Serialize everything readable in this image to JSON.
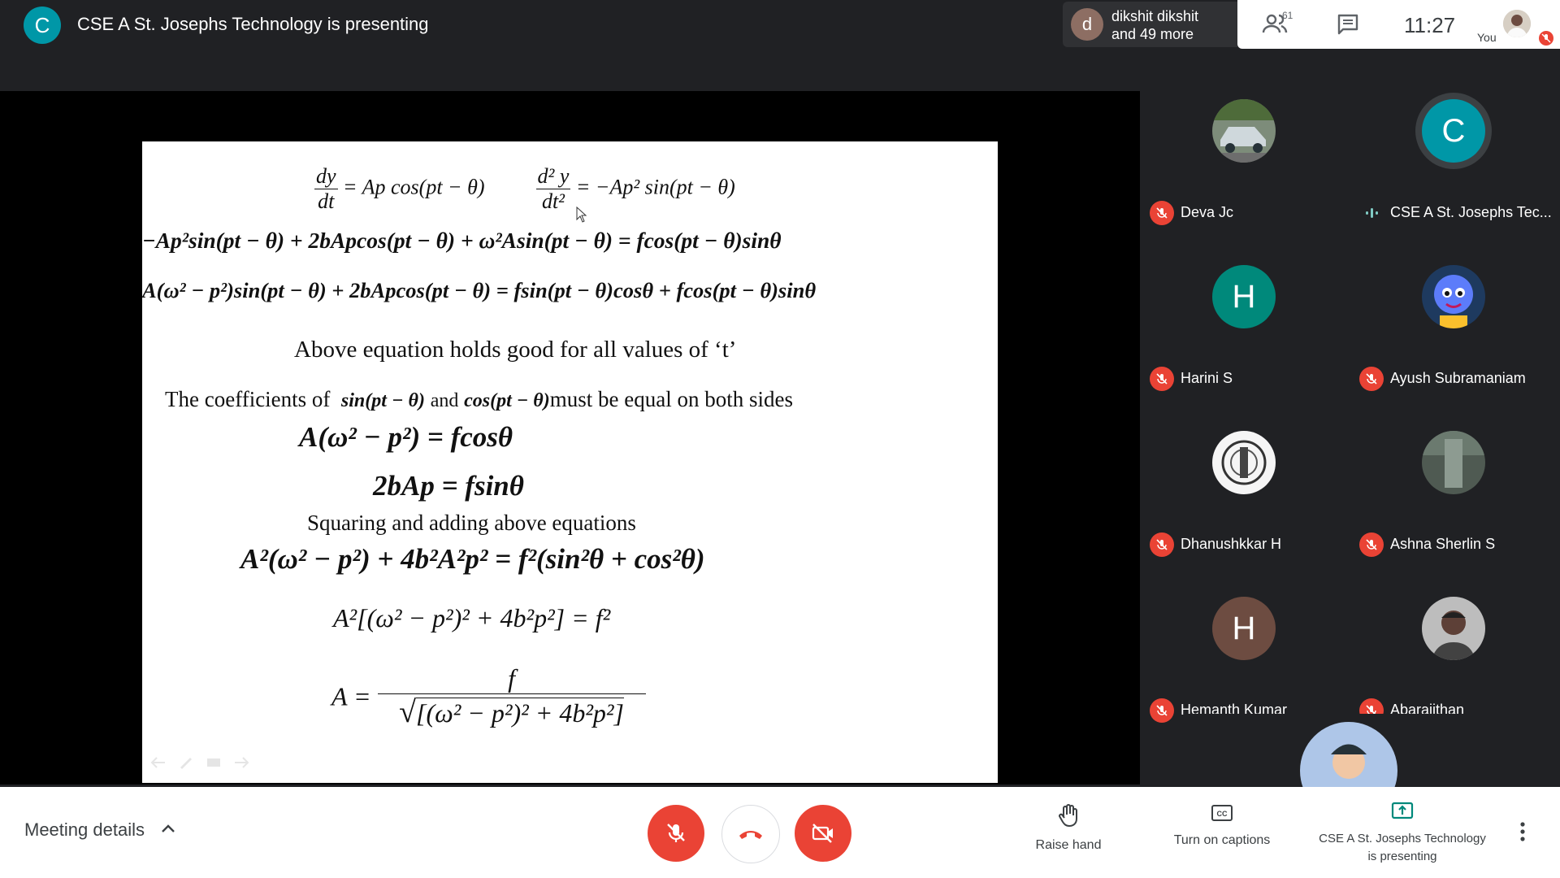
{
  "presentation": {
    "avatar_letter": "C",
    "title": "CSE A St. Josephs Technology is presenting"
  },
  "participants_chip": {
    "avatar_letter": "d",
    "line1": "dikshit dikshit",
    "line2": "and 49 more"
  },
  "top_right": {
    "participant_count": "61",
    "time": "11:27",
    "self_label": "You"
  },
  "slide": {
    "eq1_left_num": "dy",
    "eq1_left_den": "dt",
    "eq1_left_rhs": "= Ap cos(pt − θ)",
    "eq1_right_num": "d² y",
    "eq1_right_den": "dt²",
    "eq1_right_rhs": "= −Ap² sin(pt − θ)",
    "eq2": "−Ap²sin(pt − θ) + 2bApcos(pt − θ) + ω²Asin(pt − θ) = fcos(pt − θ)sinθ",
    "eq3": "A(ω² − p²)sin(pt − θ) + 2bApcos(pt − θ) = fsin(pt − θ)cosθ + fcos(pt − θ)sinθ",
    "text1": "Above equation holds good for all values of ‘t’",
    "text2_a": "The coefficients of",
    "text2_b": "sin(pt − θ)",
    "text2_c": "and",
    "text2_d": "cos(pt − θ)",
    "text2_e": "must be equal on both sides",
    "eq4": "A(ω² − p²) = fcosθ",
    "eq5": "2bAp = fsinθ",
    "text3": "Squaring and adding above equations",
    "eq6": "A²(ω² − p²) + 4b²A²p² = f²(sin²θ + cos²θ)",
    "eq7": "A²[(ω² − p²)² + 4b²p²] = f²",
    "eq8_lhs": "A =",
    "eq8_num": "f",
    "eq8_den": "[(ω² − p²)² + 4b²p²]"
  },
  "participants": [
    {
      "name": "Deva Jc",
      "muted": true,
      "avatar_type": "photo",
      "avatar_color": "#9e9e9e"
    },
    {
      "name": "CSE A St. Josephs Tec...",
      "muted": false,
      "avatar_type": "letter",
      "letter": "C",
      "avatar_color": "#0097a7"
    },
    {
      "name": "Harini S",
      "muted": true,
      "avatar_type": "letter",
      "letter": "H",
      "avatar_color": "#00897b"
    },
    {
      "name": "Ayush Subramaniam",
      "muted": true,
      "avatar_type": "photo",
      "avatar_color": "#3f51b5"
    },
    {
      "name": "Dhanushkkar H",
      "muted": true,
      "avatar_type": "photo",
      "avatar_color": "#e0e0e0"
    },
    {
      "name": "Ashna Sherlin S",
      "muted": true,
      "avatar_type": "photo",
      "avatar_color": "#616161"
    },
    {
      "name": "Hemanth Kumar",
      "muted": true,
      "avatar_type": "letter",
      "letter": "H",
      "avatar_color": "#6d4c41"
    },
    {
      "name": "Abarajithan",
      "muted": true,
      "avatar_type": "photo",
      "avatar_color": "#757575"
    }
  ],
  "bottom": {
    "meeting_details": "Meeting details",
    "raise_hand": "Raise hand",
    "captions": "Turn on captions",
    "presenting_line1": "CSE A St. Josephs Technology",
    "presenting_line2": "is presenting"
  },
  "colors": {
    "danger": "#ea4335",
    "background": "#202124",
    "accent_teal": "#00897b"
  }
}
